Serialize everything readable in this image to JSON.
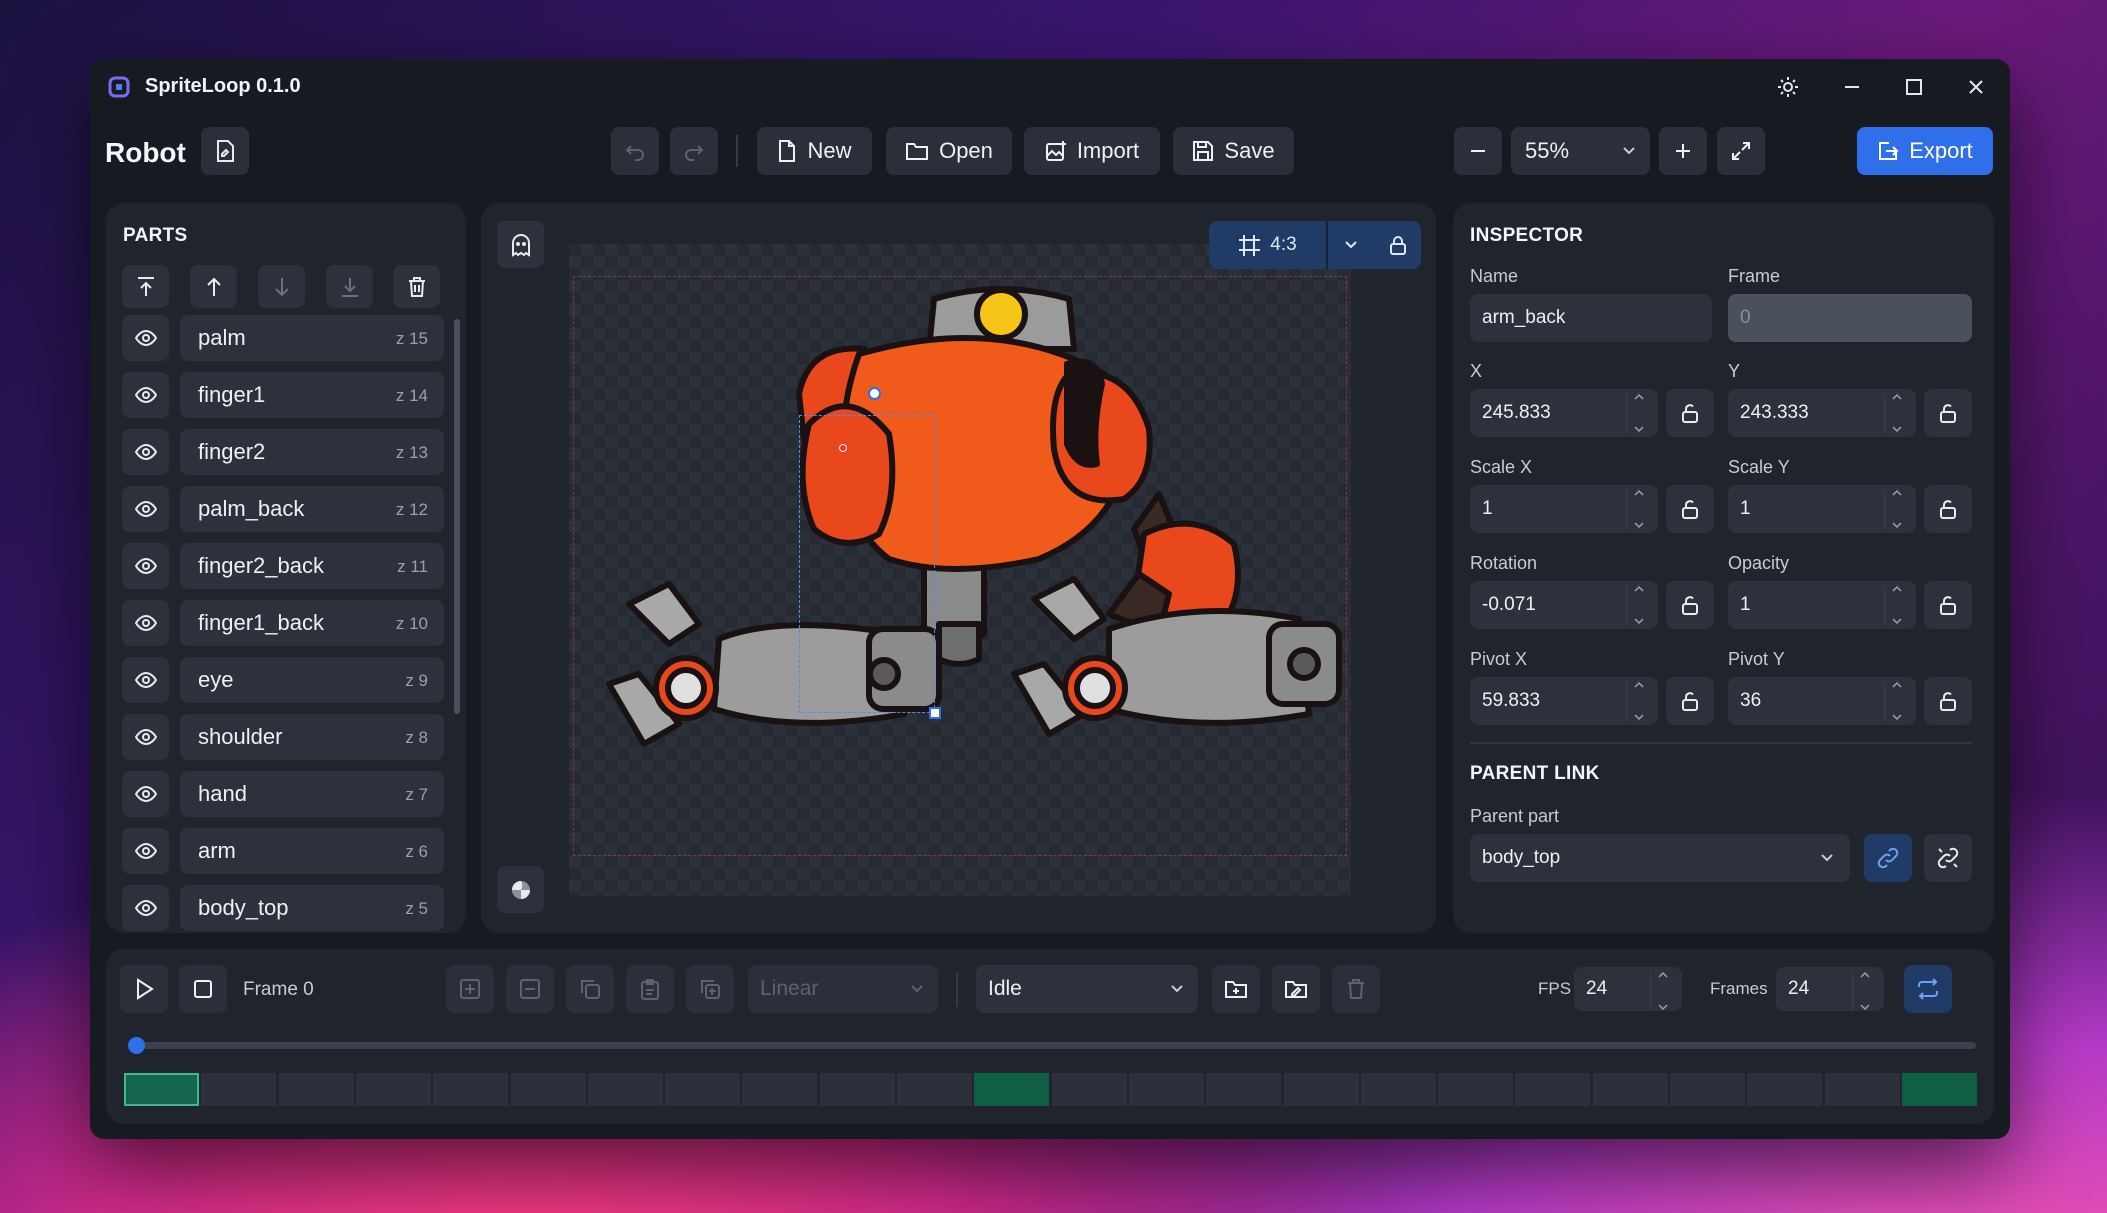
{
  "app": {
    "title": "SpriteLoop 0.1.0",
    "icon": "app-logo-icon"
  },
  "project": {
    "name": "Robot"
  },
  "toolbar": {
    "new": "New",
    "open": "Open",
    "import": "Import",
    "save": "Save",
    "zoom": "55%",
    "export": "Export"
  },
  "parts": {
    "title": "PARTS",
    "items": [
      {
        "name": "palm",
        "z": "z 15"
      },
      {
        "name": "finger1",
        "z": "z 14"
      },
      {
        "name": "finger2",
        "z": "z 13"
      },
      {
        "name": "palm_back",
        "z": "z 12"
      },
      {
        "name": "finger2_back",
        "z": "z 11"
      },
      {
        "name": "finger1_back",
        "z": "z 10"
      },
      {
        "name": "eye",
        "z": "z 9"
      },
      {
        "name": "shoulder",
        "z": "z 8"
      },
      {
        "name": "hand",
        "z": "z 7"
      },
      {
        "name": "arm",
        "z": "z 6"
      },
      {
        "name": "body_top",
        "z": "z 5"
      }
    ]
  },
  "canvas": {
    "aspect": "4:3"
  },
  "inspector": {
    "title": "INSPECTOR",
    "name_label": "Name",
    "name": "arm_back",
    "frame_label": "Frame",
    "frame": "0",
    "x_label": "X",
    "x": "245.833",
    "y_label": "Y",
    "y": "243.333",
    "scalex_label": "Scale X",
    "scalex": "1",
    "scaley_label": "Scale Y",
    "scaley": "1",
    "rotation_label": "Rotation",
    "rotation": "-0.071",
    "opacity_label": "Opacity",
    "opacity": "1",
    "pivotx_label": "Pivot X",
    "pivotx": "59.833",
    "pivoty_label": "Pivot Y",
    "pivoty": "36"
  },
  "parent_link": {
    "title": "PARENT LINK",
    "label": "Parent part",
    "value": "body_top"
  },
  "timeline": {
    "frame_label": "Frame 0",
    "easing": "Linear",
    "animation": "Idle",
    "fps_label": "FPS",
    "fps": "24",
    "frames_label": "Frames",
    "frames": "24",
    "keyframes": [
      0,
      11,
      23
    ],
    "current": 0
  },
  "colors": {
    "accent": "#2f6fea",
    "keyframe": "#0f5f46",
    "current": "#13664d"
  }
}
